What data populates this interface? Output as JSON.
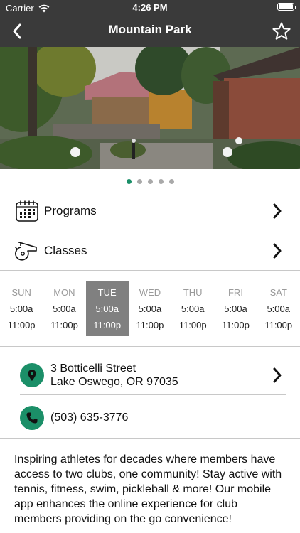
{
  "status_bar": {
    "carrier": "Carrier",
    "time": "4:26 PM"
  },
  "nav": {
    "title": "Mountain Park",
    "back_icon": "chevron-left-icon",
    "favorite_icon": "star-outline-icon"
  },
  "carousel": {
    "page_count": 5,
    "active_index": 0
  },
  "menu": [
    {
      "label": "Programs",
      "icon": "calendar-icon"
    },
    {
      "label": "Classes",
      "icon": "whistle-icon"
    }
  ],
  "hours": [
    {
      "day": "SUN",
      "open": "5:00a",
      "close": "11:00p",
      "active": false
    },
    {
      "day": "MON",
      "open": "5:00a",
      "close": "11:00p",
      "active": false
    },
    {
      "day": "TUE",
      "open": "5:00a",
      "close": "11:00p",
      "active": true
    },
    {
      "day": "WED",
      "open": "5:00a",
      "close": "11:00p",
      "active": false
    },
    {
      "day": "THU",
      "open": "5:00a",
      "close": "11:00p",
      "active": false
    },
    {
      "day": "FRI",
      "open": "5:00a",
      "close": "11:00p",
      "active": false
    },
    {
      "day": "SAT",
      "open": "5:00a",
      "close": "11:00p",
      "active": false
    }
  ],
  "address": {
    "line1": "3 Botticelli Street",
    "line2": "Lake Oswego, OR 97035",
    "icon": "location-pin-icon"
  },
  "phone": {
    "number": "(503) 635-3776",
    "icon": "phone-icon"
  },
  "description": "Inspiring athletes for decades where members have access to two clubs, one community!  Stay active with tennis, fitness, swim, pickleball & more!  Our mobile app enhances the online experience for club members providing on the go convenience!",
  "colors": {
    "nav_bg": "#3a3a3a",
    "accent": "#1b8f68",
    "active_day_bg": "#808080"
  }
}
